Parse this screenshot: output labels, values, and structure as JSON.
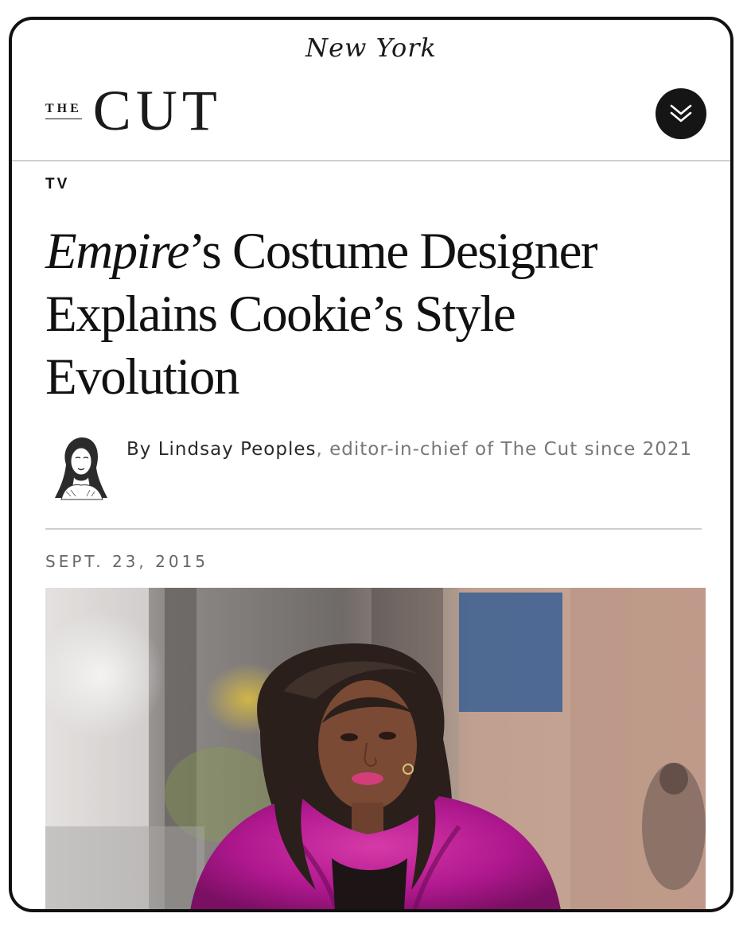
{
  "masthead": {
    "nymag_logo": "New York",
    "cut_logo_the": "THE",
    "cut_logo_cut": "CUT",
    "menu_icon": "double-chevron-down-icon"
  },
  "article": {
    "rubric": "TV",
    "headline_italic": "Empire",
    "headline_rest": "’s Costume Designer Explains Cookie’s Style Evolution",
    "byline": {
      "prefix": "By ",
      "author": "Lindsay Peoples",
      "description": ", editor-in-chief of The Cut since 2021",
      "avatar_icon": "author-portrait-sketch"
    },
    "date": "SEPT. 23, 2015",
    "hero_image": "woman-in-magenta-fur-coat-photo"
  },
  "colors": {
    "text": "#111111",
    "muted": "#777777",
    "divider": "#cfcfcf",
    "menu_button": "#151515",
    "fur": "#b0188f"
  }
}
